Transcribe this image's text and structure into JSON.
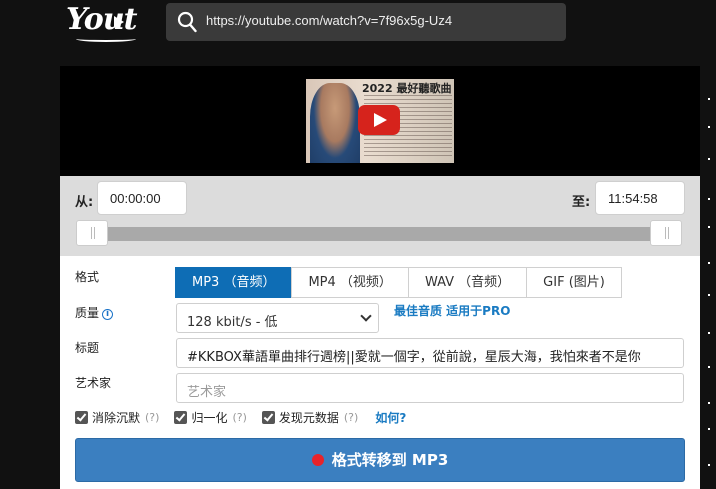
{
  "header": {
    "logo_text": "Yout",
    "url": "https://youtube.com/watch?v=7f96x5g-Uz4"
  },
  "video": {
    "thumbnail_title": "2022 最好聽歌曲"
  },
  "range": {
    "from_label": "从:",
    "from_value": "00:00:00",
    "to_label": "至:",
    "to_value": "11:54:58"
  },
  "form": {
    "format_label": "格式",
    "formats": [
      "MP3 （音频）",
      "MP4 （视频）",
      "WAV （音频）",
      "GIF (图片)"
    ],
    "selected_format": "MP3 （音频）",
    "quality_label": "质量",
    "quality_value": "128 kbit/s - 低",
    "best_quality_link": "最佳音质 适用于PRO",
    "title_label": "标题",
    "title_value": "#KKBOX華語單曲排行週榜||愛就一個字，從前說，星辰大海，我怕來者不是你",
    "artist_label": "艺术家",
    "artist_placeholder": "艺术家",
    "checkboxes": [
      {
        "label": "消除沉默",
        "help": "(?)",
        "checked": true
      },
      {
        "label": "归一化",
        "help": "(?)",
        "checked": true
      },
      {
        "label": "发现元数据",
        "help": "(?)",
        "checked": true
      }
    ],
    "how_link": "如何?",
    "convert_button": "格式转移到 MP3"
  }
}
